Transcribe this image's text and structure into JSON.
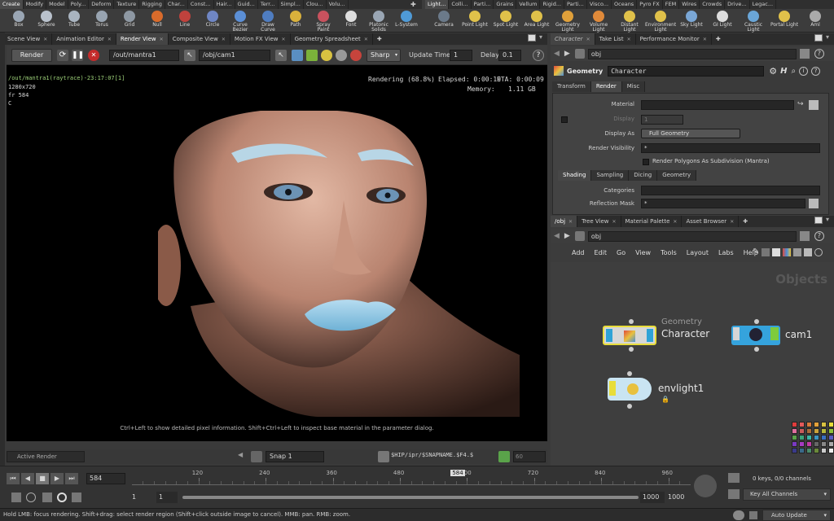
{
  "shelf_left": {
    "tabs": [
      "Create",
      "Modify",
      "Model",
      "Poly...",
      "Deform",
      "Texture",
      "Rigging",
      "Char...",
      "Const...",
      "Hair...",
      "Guid...",
      "Terr...",
      "Simpl...",
      "Clou...",
      "Volu..."
    ],
    "active_tab": 0,
    "tools": [
      {
        "label": "Box",
        "color": "#9aa6b4",
        "icon": "box-icon"
      },
      {
        "label": "Sphere",
        "color": "#b9c1cc",
        "icon": "sphere-icon"
      },
      {
        "label": "Tube",
        "color": "#a9b4c0",
        "icon": "tube-icon"
      },
      {
        "label": "Torus",
        "color": "#98a4b1",
        "icon": "torus-icon"
      },
      {
        "label": "Grid",
        "color": "#8e98a3",
        "icon": "grid-icon"
      },
      {
        "label": "Null",
        "color": "#d96b2b",
        "icon": "null-icon"
      },
      {
        "label": "Line",
        "color": "#c0423d",
        "icon": "line-icon"
      },
      {
        "label": "Circle",
        "color": "#6f86c4",
        "icon": "circle-icon"
      },
      {
        "label": "Curve Bezier",
        "color": "#5b8fd6",
        "icon": "curve-bezier-icon"
      },
      {
        "label": "Draw Curve",
        "color": "#4f7dc0",
        "icon": "draw-curve-icon"
      },
      {
        "label": "Path",
        "color": "#d9b13c",
        "icon": "path-icon"
      },
      {
        "label": "Spray Paint",
        "color": "#c8525e",
        "icon": "spray-paint-icon"
      },
      {
        "label": "Font",
        "color": "#dddddd",
        "icon": "font-icon"
      },
      {
        "label": "Platonic Solids",
        "color": "#9aa6b4",
        "icon": "platonic-solids-icon"
      },
      {
        "label": "L-System",
        "color": "#4f9ad6",
        "icon": "l-system-icon"
      }
    ]
  },
  "shelf_right": {
    "tabs": [
      "Light...",
      "Colli...",
      "Parti...",
      "Grains",
      "Vellum",
      "Rigid...",
      "Parti...",
      "Visco...",
      "Oceans",
      "Pyro FX",
      "FEM",
      "Wires",
      "Crowds",
      "Drive...",
      "Legac..."
    ],
    "active_tab": 0,
    "tools": [
      {
        "label": "Camera",
        "color": "#6b7a8a",
        "icon": "camera-icon"
      },
      {
        "label": "Point Light",
        "color": "#e0c14a",
        "icon": "point-light-icon"
      },
      {
        "label": "Spot Light",
        "color": "#e0c14a",
        "icon": "spot-light-icon"
      },
      {
        "label": "Area Light",
        "color": "#e0c14a",
        "icon": "area-light-icon"
      },
      {
        "label": "Geometry Light",
        "color": "#e0a03a",
        "icon": "geometry-light-icon"
      },
      {
        "label": "Volume Light",
        "color": "#e08a3a",
        "icon": "volume-light-icon"
      },
      {
        "label": "Distant Light",
        "color": "#e0c14a",
        "icon": "distant-light-icon"
      },
      {
        "label": "Environment Light",
        "color": "#e0c14a",
        "icon": "environment-light-icon"
      },
      {
        "label": "Sky Light",
        "color": "#7aa7d6",
        "icon": "sky-light-icon"
      },
      {
        "label": "GI Light",
        "color": "#dddddd",
        "icon": "gi-light-icon"
      },
      {
        "label": "Caustic Light",
        "color": "#6aa6d8",
        "icon": "caustic-light-icon"
      },
      {
        "label": "Portal Light",
        "color": "#e0c14a",
        "icon": "portal-light-icon"
      },
      {
        "label": "Aml",
        "color": "#aaaaaa",
        "icon": "ambient-light-icon"
      }
    ]
  },
  "left_pane_tabs": [
    "Scene View",
    "Animation Editor",
    "Render View",
    "Composite View",
    "Motion FX View",
    "Geometry Spreadsheet"
  ],
  "left_active_tab": 2,
  "render_toolbar": {
    "render_label": "Render",
    "output_path": "/out/mantra1",
    "camera_path": "/obj/cam1",
    "sharp_label": "Sharp",
    "update_time_label": "Update Time",
    "update_time_value": "1",
    "delay_label": "Delay",
    "delay_value": "0.1"
  },
  "render_info": {
    "title": "/out/mantra1(raytrace)-23:17:07[1]",
    "resolution": "1280x720",
    "frame": "fr 584",
    "channel": "C",
    "progress": "Rendering (68.8%)",
    "elapsed": "Elapsed: 0:00:19",
    "eta": "ETA: 0:00:09",
    "memory": "Memory:",
    "memory_value": "1.11 GB",
    "hint": "Ctrl+Left to show detailed pixel information. Shift+Ctrl+Left to inspect base material in the parameter dialog."
  },
  "viewer_bottom": {
    "active_render": "Active Render",
    "snap": "Snap 1",
    "snapname": "$HIP/ipr/$SNAPNAME.$F4.$",
    "num": "60"
  },
  "timeline": {
    "frame": "584",
    "range_start": "1",
    "range_start2": "1",
    "range_end": "1000",
    "range_end2": "1000",
    "ticks": [
      "120",
      "240",
      "360",
      "480",
      "600",
      "720",
      "840",
      "960"
    ],
    "current_marker": "584",
    "keys": "0 keys, 0/0 channels",
    "key_all": "Key All Channels"
  },
  "status": {
    "hint": "Hold LMB: focus rendering. Shift+drag: select render region (Shift+click outside image to cancel). MMB: pan. RMB: zoom.",
    "auto_update": "Auto Update"
  },
  "param_pane": {
    "tabs": [
      "Character",
      "Take List",
      "Performance Monitor"
    ],
    "path": "obj",
    "node_type": "Geometry",
    "node_name": "Character",
    "main_tabs": [
      "Transform",
      "Render",
      "Misc"
    ],
    "main_active": 1,
    "material_label": "Material",
    "display_label": "Display",
    "display_value": "1",
    "display_as_label": "Display As",
    "display_as_value": "Full Geometry",
    "render_vis_label": "Render Visibility",
    "render_vis_value": "*",
    "render_poly_label": "Render Polygons As Subdivision (Mantra)",
    "sub_tabs": [
      "Shading",
      "Sampling",
      "Dicing",
      "Geometry"
    ],
    "sub_active": 0,
    "categories_label": "Categories",
    "reflection_label": "Reflection Mask",
    "reflection_value": "*"
  },
  "net_pane": {
    "tabs": [
      "/obj",
      "Tree View",
      "Material Palette",
      "Asset Browser"
    ],
    "path": "obj",
    "menu": [
      "Add",
      "Edit",
      "Go",
      "View",
      "Tools",
      "Layout",
      "Labs",
      "Help"
    ],
    "context_label": "Objects",
    "nodes": {
      "character_type": "Geometry",
      "character_name": "Character",
      "cam_name": "cam1",
      "light_name": "envlight1"
    }
  }
}
